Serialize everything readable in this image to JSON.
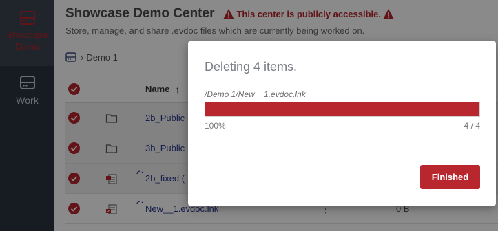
{
  "sidebar": {
    "items": [
      {
        "label": "Showcase Demo",
        "icon": "drive-icon",
        "active": true
      },
      {
        "label": "Work",
        "icon": "drive-icon",
        "active": false
      }
    ]
  },
  "header": {
    "title": "Showcase Demo Center",
    "warning": "This center is publicly accessible.",
    "subtitle": "Store, manage, and share .evdoc files which are currently being worked on."
  },
  "breadcrumb": {
    "icon": "drive-icon",
    "items": [
      "Demo 1"
    ]
  },
  "table": {
    "columns": {
      "name": "Name",
      "sort_icon": "sort-up-arrow"
    },
    "rows": [
      {
        "name": "2b_Public",
        "icon": "folder-icon",
        "size": ""
      },
      {
        "name": "3b_Public",
        "icon": "folder-icon",
        "size": ""
      },
      {
        "name": "2b_fixed (",
        "icon": "evdoc-file-icon",
        "size": ""
      },
      {
        "name": "New__1.evdoc.lnk",
        "icon": "evdoc-link-icon",
        "size": "0 B"
      }
    ]
  },
  "dialog": {
    "title": "Deleting 4 items.",
    "current_path": "/Demo 1/New__1.evdoc.lnk",
    "progress": 1.0,
    "percent_label": "100%",
    "count_label": "4 / 4",
    "button_label": "Finished"
  },
  "colors": {
    "accent": "#b8262e",
    "sidebar_bg": "#2c3440",
    "link": "#2a3a8c"
  }
}
